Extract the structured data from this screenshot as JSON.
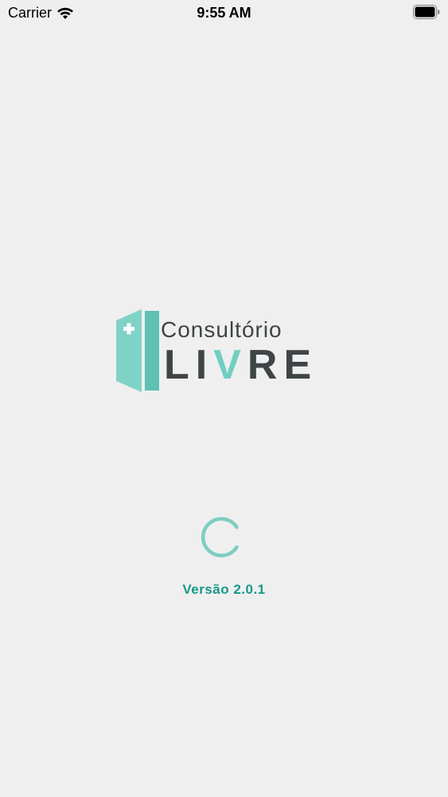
{
  "status_bar": {
    "carrier": "Carrier",
    "time": "9:55 AM"
  },
  "logo": {
    "line1": "Consultório",
    "line2_prefix": "LI",
    "line2_accent": "V",
    "line2_suffix": "RE",
    "accent_color": "#6fcfc0",
    "text_color": "#3f4446"
  },
  "loading": {
    "version_text": "Versão 2.0.1",
    "version_color": "#17988a",
    "spinner_color": "#7ecdc2"
  }
}
